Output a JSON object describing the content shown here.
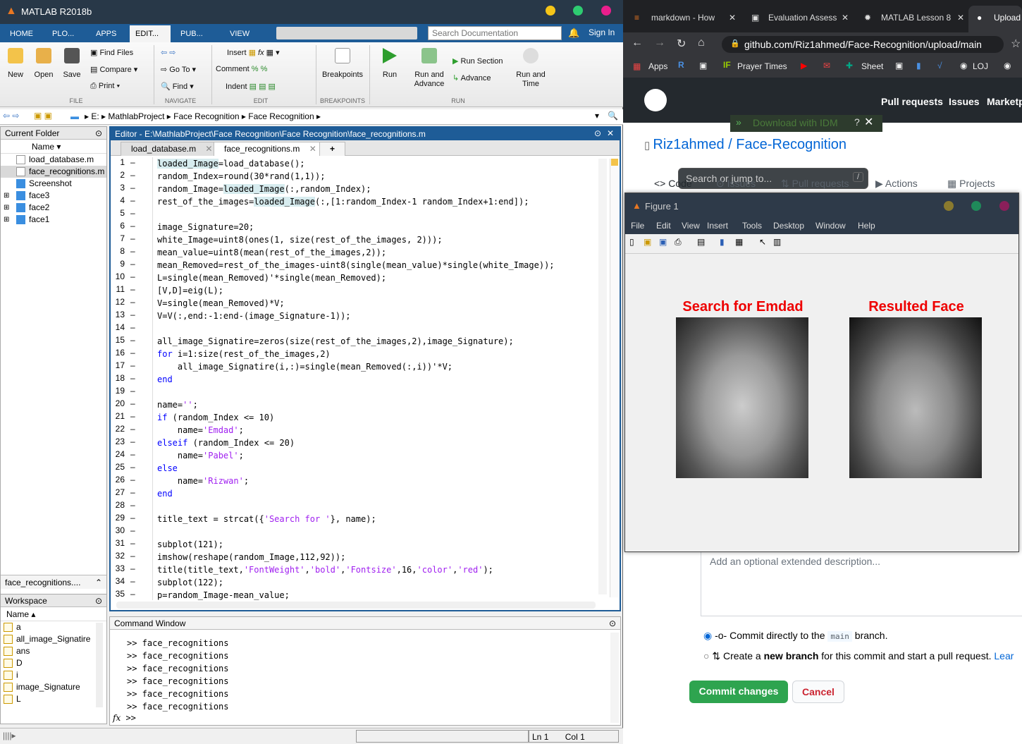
{
  "matlab": {
    "title": "MATLAB R2018b",
    "tabs": [
      "HOME",
      "PLO...",
      "APPS",
      "EDIT...",
      "PUB...",
      "VIEW"
    ],
    "search_placeholder": "Search Documentation",
    "signin": "Sign In",
    "ribbon": {
      "file": {
        "new": "New",
        "open": "Open",
        "save": "Save",
        "find_files": "Find Files",
        "compare": "Compare",
        "print": "Print",
        "label": "FILE"
      },
      "navigate": {
        "goto": "Go To",
        "find": "Find",
        "label": "NAVIGATE"
      },
      "edit": {
        "insert": "Insert",
        "comment": "Comment",
        "indent": "Indent",
        "fx": "fx",
        "label": "EDIT"
      },
      "breakpoints": {
        "breakpoints": "Breakpoints",
        "label": "BREAKPOINTS"
      },
      "run": {
        "run": "Run",
        "run_advance": "Run and Advance",
        "run_section": "Run Section",
        "advance": "Advance",
        "run_time": "Run and Time",
        "label": "RUN"
      }
    },
    "path": [
      "E:",
      "MathlabProject",
      "Face Recognition",
      "Face Recognition"
    ],
    "current_folder": {
      "title": "Current Folder",
      "col": "Name",
      "items": [
        {
          "name": "load_database.m",
          "type": "m"
        },
        {
          "name": "face_recognitions.m",
          "type": "m"
        },
        {
          "name": "Screenshot",
          "type": "folder"
        },
        {
          "name": "face3",
          "type": "folder"
        },
        {
          "name": "face2",
          "type": "folder"
        },
        {
          "name": "face1",
          "type": "folder"
        }
      ],
      "details": "face_recognitions...."
    },
    "editor": {
      "title": "Editor - E:\\MathlabProject\\Face Recognition\\Face Recognition\\face_recognitions.m",
      "tabs": [
        "load_database.m",
        "face_recognitions.m"
      ]
    },
    "workspace": {
      "title": "Workspace",
      "col": "Name",
      "items": [
        "a",
        "all_image_Signatire",
        "ans",
        "D",
        "i",
        "image_Signature",
        "L"
      ]
    },
    "command_window": {
      "title": "Command Window",
      "lines": [
        ">> face_recognitions",
        ">> face_recognitions",
        ">> face_recognitions",
        ">> face_recognitions",
        ">> face_recognitions",
        ">> face_recognitions"
      ],
      "prompt": ">>"
    },
    "status": {
      "ln_label": "Ln",
      "ln": "1",
      "col_label": "Col",
      "col": "1"
    }
  },
  "browser": {
    "tabs": [
      "markdown - How",
      "Evaluation Assess",
      "MATLAB Lesson 8",
      "Upload"
    ],
    "url": "github.com/Riz1ahmed/Face-Recognition/upload/main",
    "bookmarks": [
      "Apps",
      "Prayer Times",
      "Sheet",
      "LOJ"
    ],
    "gh_search": "Search or jump to...",
    "gh_nav": [
      "Pull requests",
      "Issues",
      "Marketp"
    ],
    "idm": "Download with IDM",
    "repo_owner": "Riz1ahmed",
    "repo_name": "Face-Recognition",
    "repo_tabs": [
      "Code",
      "Issues",
      "Pull requests",
      "Actions",
      "Projects"
    ],
    "desc_placeholder": "Add an optional extended description...",
    "commit_direct": "Commit directly to the",
    "branch": "main",
    "branch_suffix": "branch.",
    "commit_new_a": "Create a",
    "commit_new_b": "new branch",
    "commit_new_c": "for this commit and start a pull request.",
    "learn": "Lear",
    "commit_btn": "Commit changes",
    "cancel_btn": "Cancel"
  },
  "figure": {
    "title": "Figure 1",
    "menu": [
      "File",
      "Edit",
      "View",
      "Insert",
      "Tools",
      "Desktop",
      "Window",
      "Help"
    ],
    "left_title": "Search for Emdad",
    "right_title": "Resulted Face"
  },
  "colors": {
    "matlab_blue": "#1e5c97",
    "github_green": "#2ea44f",
    "cancel_red": "#cb2431",
    "fig_red": "#e00000"
  }
}
